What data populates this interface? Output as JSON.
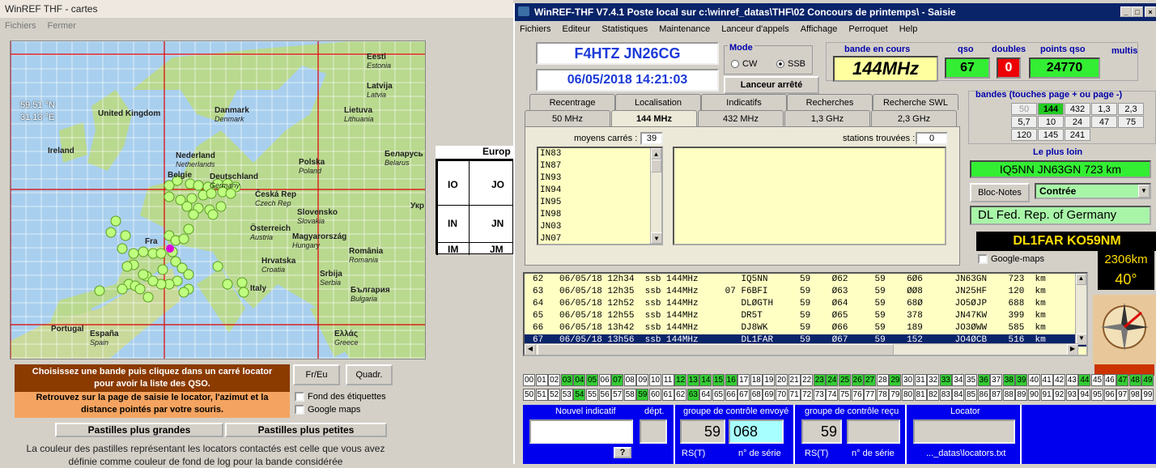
{
  "left": {
    "title": "WinREF THF - cartes",
    "menu": [
      "Fichiers",
      "Fermer"
    ],
    "coords": {
      "lat": "59.51 °N",
      "lon": "31.13 °E"
    },
    "countries": [
      {
        "name": "Eesti",
        "sub": "Estonia"
      },
      {
        "name": "Latvija",
        "sub": "Latvia"
      },
      {
        "name": "Lietuva",
        "sub": "Lithuania"
      },
      {
        "name": "United Kingdom",
        "sub": ""
      },
      {
        "name": "Danmark",
        "sub": "Denmark"
      },
      {
        "name": "Ireland",
        "sub": ""
      },
      {
        "name": "Nederland",
        "sub": "Netherlands"
      },
      {
        "name": "Belgie",
        "sub": ""
      },
      {
        "name": "Deutschland",
        "sub": "Germany"
      },
      {
        "name": "Polska",
        "sub": "Poland"
      },
      {
        "name": "Беларусь",
        "sub": "Belarus"
      },
      {
        "name": "Česká Rep",
        "sub": "Czech Rep"
      },
      {
        "name": "Slovensko",
        "sub": "Slovakia"
      },
      {
        "name": "Österreich",
        "sub": "Austria"
      },
      {
        "name": "Magyarország",
        "sub": "Hungary"
      },
      {
        "name": "Fra",
        "sub": ""
      },
      {
        "name": "România",
        "sub": "Romania"
      },
      {
        "name": "Hrvatska",
        "sub": "Croatia"
      },
      {
        "name": "Srbija",
        "sub": "Serbia"
      },
      {
        "name": "Italy",
        "sub": ""
      },
      {
        "name": "България",
        "sub": "Bulgaria"
      },
      {
        "name": "Portugal",
        "sub": ""
      },
      {
        "name": "España",
        "sub": "Spain"
      },
      {
        "name": "Ελλάς",
        "sub": "Greece"
      },
      {
        "name": "Укр",
        "sub": ""
      }
    ],
    "grid": {
      "header": "Europ",
      "cells": [
        "IO",
        "JO",
        "IN",
        "JN",
        "IM",
        "JM"
      ]
    },
    "instructions_top": "Choisissez une bande puis cliquez dans un carré locator  pour avoir la liste des QSO.",
    "instructions_bottom": "Retrouvez sur la page de saisie le locator, l'azimut et la distance pointés par votre souris.",
    "btn_freu": "Fr/Eu",
    "btn_quadr": "Quadr.",
    "chk_fond": "Fond des étiquettes",
    "chk_gmaps": "Google maps",
    "btn_bigger": "Pastilles plus grandes",
    "btn_smaller": "Pastilles plus petites",
    "footer": "La couleur des pastilles représentant les locators contactés est celle que vous avez définie comme couleur de fond de log pour la bande considérée"
  },
  "right": {
    "title": "WinREF-THF V7.4.1 Poste local sur c:\\winref_datas\\THF\\02 Concours de printemps\\ -  Saisie",
    "menu": [
      "Fichiers",
      "Editeur",
      "Statistiques",
      "Maintenance",
      "Lanceur d'appels",
      "Affichage",
      "Perroquet",
      "Help"
    ],
    "station": "F4HTZ  JN26CG",
    "datetime": "06/05/2018   14:21:03",
    "mode_label": "Mode",
    "mode_cw": "CW",
    "mode_ssb": "SSB",
    "launcher": "Lanceur arrêté",
    "band_label": "bande en cours",
    "band": "144MHz",
    "qso_label": "qso",
    "qso": "67",
    "doubles_label": "doubles",
    "doubles": "0",
    "points_label": "points qso",
    "points": "24770",
    "multis_label": "multis",
    "tabs_row1": [
      "Recentrage",
      "Localisation",
      "Indicatifs",
      "Recherches",
      "Recherche SWL"
    ],
    "tabs_row2": [
      "50 MHz",
      "144 MHz",
      "432 MHz",
      "1,3 GHz",
      "2,3 GHz"
    ],
    "moyens_label": "moyens carrés :",
    "moyens_count": "39",
    "stations_label": "stations trouvées :",
    "stations_count": "0",
    "squares": [
      "IN83",
      "IN87",
      "IN93",
      "IN94",
      "IN95",
      "IN98",
      "JN03",
      "JN07"
    ],
    "bands_label": "bandes (touches page + ou page -)",
    "bands": [
      "50",
      "144",
      "432",
      "1,3",
      "2,3",
      "5,7",
      "10",
      "24",
      "47",
      "75",
      "120",
      "145",
      "241"
    ],
    "farthest_label": "Le plus loin",
    "farthest": "IQ5NN JN63GN  723 km",
    "bloc_notes": "Bloc-Notes",
    "contree": "Contrée",
    "country": "DL     Fed. Rep. of Germany",
    "last_call": "DL1FAR   KO59NM",
    "google_maps": "Google-maps",
    "distance": "2306km",
    "azimuth": "40°",
    "log": [
      "62   06/05/18 12h34  ssb 144MHz        IQ5NN      59    Ø62     59    6Ø6      JN63GN    723  km",
      "63   06/05/18 12h35  ssb 144MHz     07 F6BFI      59    Ø63     59    ØØ8      JN25HF    120  km",
      "64   06/05/18 12h52  ssb 144MHz        DLØGTH     59    Ø64     59    68Ø      JO5ØJP    688  km",
      "65   06/05/18 12h55  ssb 144MHz        DR5T       59    Ø65     59    378      JN47KW    399  km",
      "66   06/05/18 13h42  ssb 144MHz        DJ8WK      59    Ø66     59    189      JO3ØWW    585  km",
      "67   06/05/18 13h56  ssb 144MHz        DL1FAR     59    Ø67     59    152      JO4ØCB    516  km"
    ],
    "numbers_row1": [
      "00",
      "01",
      "02",
      "03",
      "04",
      "05",
      "06",
      "07",
      "08",
      "09",
      "10",
      "11",
      "12",
      "13",
      "14",
      "15",
      "16",
      "17",
      "18",
      "19",
      "20",
      "21",
      "22",
      "23",
      "24",
      "25",
      "26",
      "27",
      "28",
      "29",
      "30",
      "31",
      "32",
      "33",
      "34",
      "35",
      "36",
      "37",
      "38",
      "39",
      "40",
      "41",
      "42",
      "43",
      "44",
      "45",
      "46",
      "47",
      "48",
      "49"
    ],
    "numbers_row2": [
      "50",
      "51",
      "52",
      "53",
      "54",
      "55",
      "56",
      "57",
      "58",
      "59",
      "60",
      "61",
      "62",
      "63",
      "64",
      "65",
      "66",
      "67",
      "68",
      "69",
      "70",
      "71",
      "72",
      "73",
      "74",
      "75",
      "76",
      "77",
      "78",
      "79",
      "80",
      "81",
      "82",
      "83",
      "84",
      "85",
      "86",
      "87",
      "88",
      "89",
      "90",
      "91",
      "92",
      "93",
      "94",
      "95",
      "96",
      "97",
      "98",
      "99"
    ],
    "on_row1": [
      3,
      4,
      5,
      7,
      12,
      13,
      14,
      15,
      16,
      23,
      24,
      25,
      26,
      27,
      29,
      33,
      36,
      38,
      39,
      44,
      47,
      48,
      49
    ],
    "on_row2": [
      4,
      9,
      13
    ],
    "new_call_label": "Nouvel indicatif",
    "dept_label": "dépt.",
    "help_btn": "?",
    "sent_label": "groupe de contrôle envoyé",
    "sent_rst": "59",
    "sent_serial": "068",
    "rst_label": "RS(T)",
    "serial_label": "n° de série",
    "recv_label": "groupe de contrôle reçu",
    "recv_rst": "59",
    "locator_label": "Locator",
    "locator_file": "..._datas\\locators.txt"
  }
}
